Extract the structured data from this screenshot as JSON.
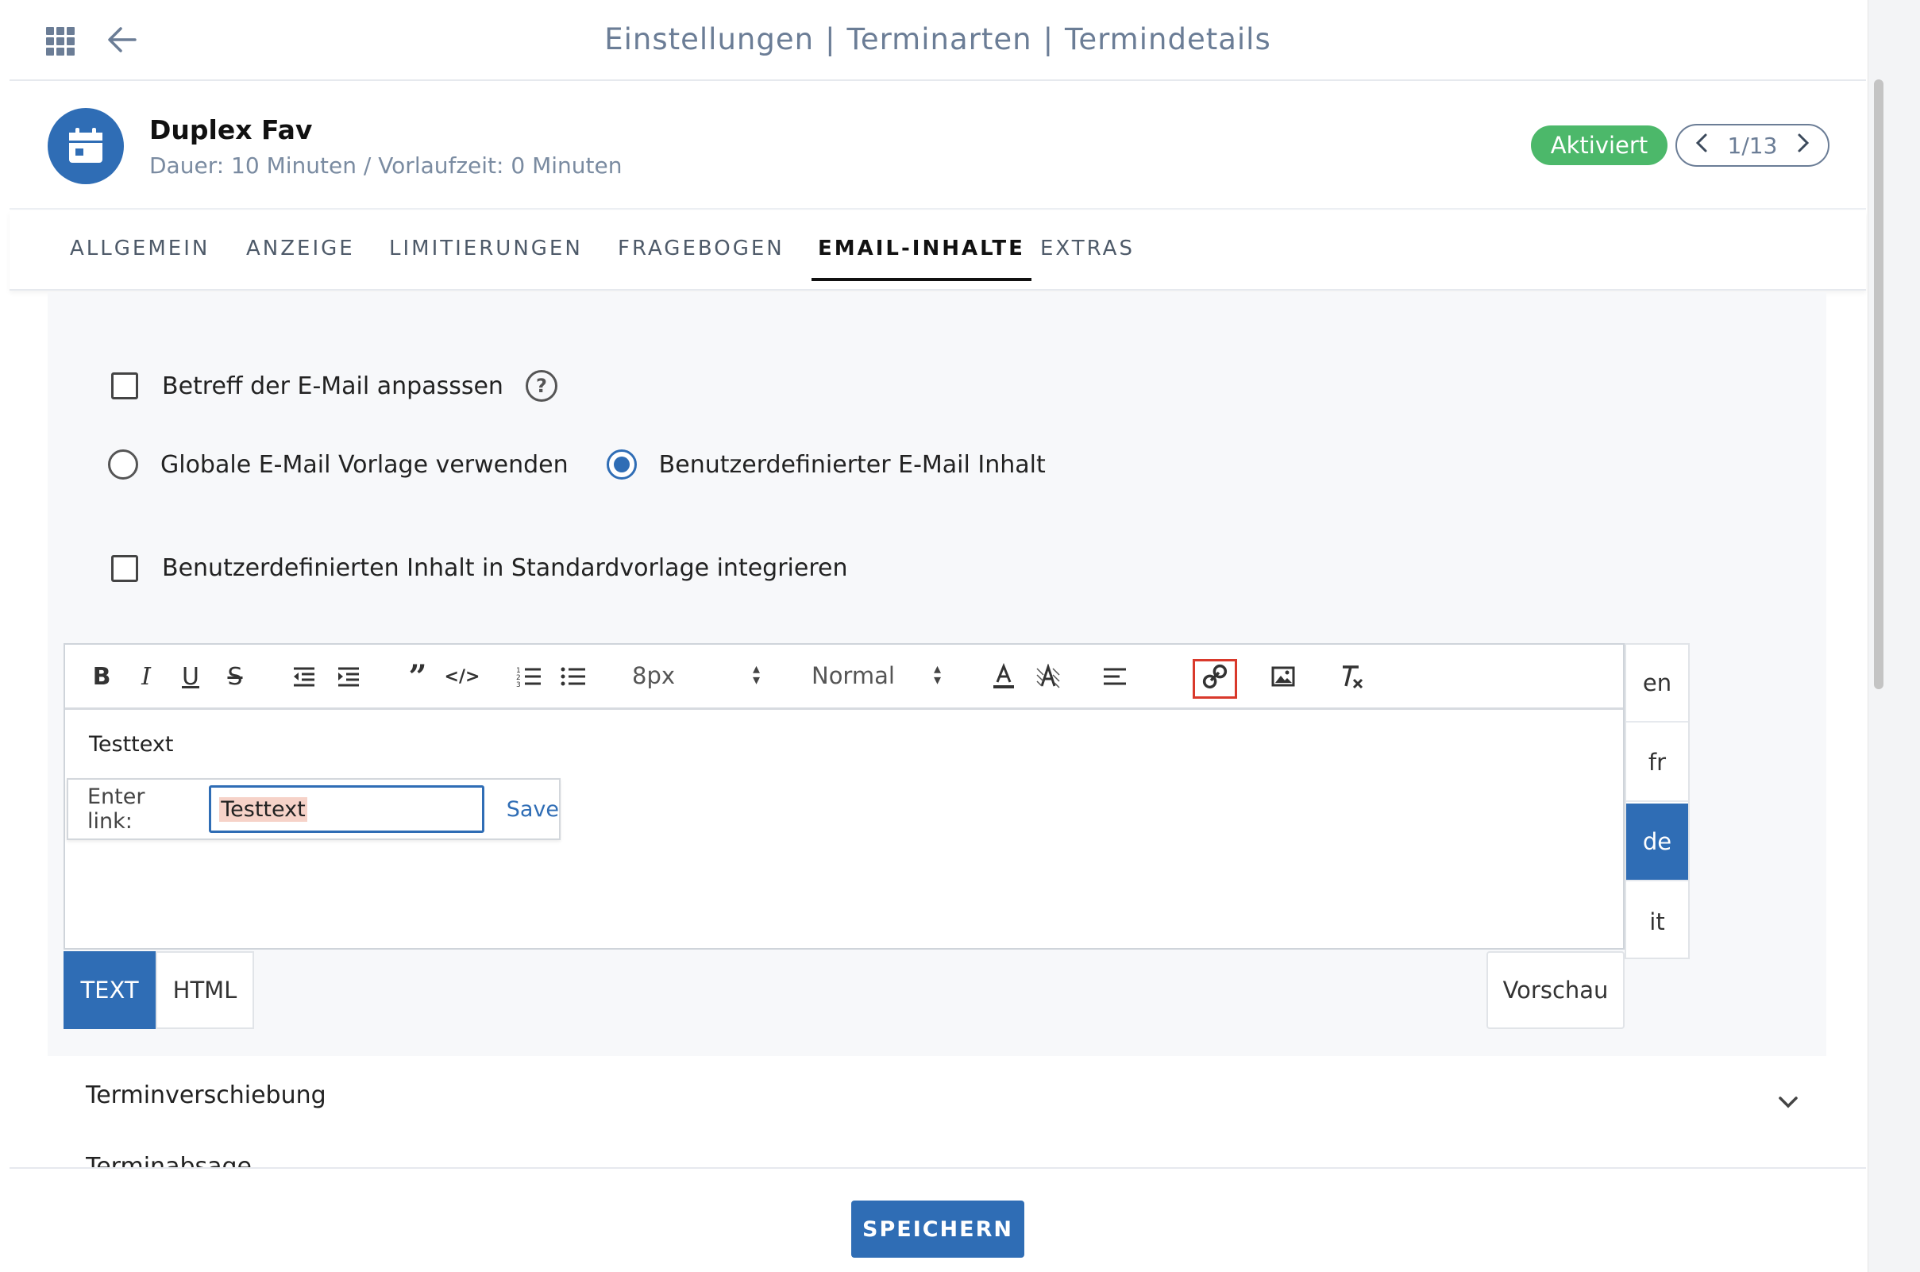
{
  "topbar": {
    "breadcrumb": [
      "Einstellungen",
      "Terminarten",
      "Termindetails"
    ],
    "separator": "|",
    "apps_icon": "apps-grid-icon",
    "back_icon": "arrow-left-icon"
  },
  "header": {
    "icon": "calendar-icon",
    "title": "Duplex Fav",
    "subtitle": "Dauer: 10 Minuten / Vorlaufzeit: 0 Minuten",
    "status": "Aktiviert",
    "pager": "1/13"
  },
  "tabs": [
    "ALLGEMEIN",
    "ANZEIGE",
    "LIMITIERUNGEN",
    "FRAGEBOGEN",
    "EMAIL-INHALTE",
    "EXTRAS"
  ],
  "active_tab": "EMAIL-INHALTE",
  "options": {
    "subject_checkbox": "Betreff der E-Mail anpasssen",
    "subject_checked": false,
    "radio_global": "Globale E-Mail Vorlage verwenden",
    "radio_custom": "Benutzerdefinierter E-Mail Inhalt",
    "selected_radio": "custom",
    "integrate_checkbox": "Benutzerdefinierten Inhalt in Standardvorlage integrieren",
    "integrate_checked": false
  },
  "editor": {
    "font_size": "8px",
    "block_format": "Normal",
    "content": "Testtext",
    "link_label": "Enter link:",
    "link_value": "Testtext",
    "link_save": "Save"
  },
  "languages": [
    "en",
    "fr",
    "de",
    "it"
  ],
  "active_language": "de",
  "modes": [
    "TEXT",
    "HTML"
  ],
  "active_mode": "TEXT",
  "preview": "Vorschau",
  "section_collapsed": "Terminverschiebung",
  "section_cut": "Terminabsage",
  "footer": {
    "save": "SPEICHERN"
  },
  "colors": {
    "primary": "#2f6db5",
    "success": "#4cb86a",
    "muted": "#6b7d96",
    "highlight": "#d9392b"
  }
}
